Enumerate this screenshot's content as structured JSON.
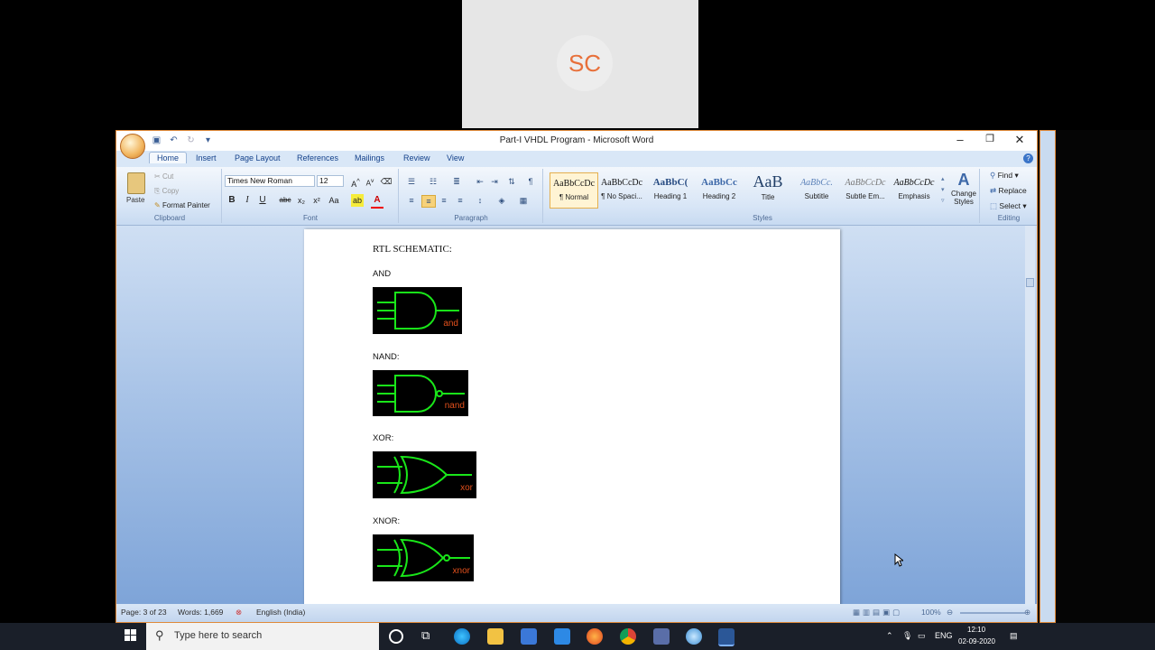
{
  "participant": {
    "initials": "SC"
  },
  "window": {
    "title": "Part-I VHDL Program - Microsoft Word",
    "tabs": [
      "Home",
      "Insert",
      "Page Layout",
      "References",
      "Mailings",
      "Review",
      "View"
    ],
    "active_tab": "Home"
  },
  "ribbon": {
    "clipboard": {
      "label": "Clipboard",
      "paste": "Paste",
      "cut": "Cut",
      "copy": "Copy",
      "format_painter": "Format Painter"
    },
    "font": {
      "label": "Font",
      "family": "Times New Roman",
      "size": "12"
    },
    "paragraph": {
      "label": "Paragraph"
    },
    "styles": {
      "label": "Styles",
      "items": [
        {
          "sample": "AaBbCcDc",
          "name": "¶ Normal"
        },
        {
          "sample": "AaBbCcDc",
          "name": "¶ No Spaci..."
        },
        {
          "sample": "AaBbC(",
          "name": "Heading 1"
        },
        {
          "sample": "AaBbCc",
          "name": "Heading 2"
        },
        {
          "sample": "AaB",
          "name": "Title"
        },
        {
          "sample": "AaBbCc.",
          "name": "Subtitle"
        },
        {
          "sample": "AaBbCcDc",
          "name": "Subtle Em..."
        },
        {
          "sample": "AaBbCcDc",
          "name": "Emphasis"
        }
      ],
      "change_styles": "Change Styles"
    },
    "editing": {
      "label": "Editing",
      "find": "Find",
      "replace": "Replace",
      "select": "Select"
    }
  },
  "document": {
    "heading": "RTL SCHEMATIC:",
    "sections": [
      {
        "label": "AND",
        "gate_label": "and"
      },
      {
        "label": "NAND:",
        "gate_label": "nand"
      },
      {
        "label": "XOR:",
        "gate_label": "xor"
      },
      {
        "label": "XNOR:",
        "gate_label": "xnor"
      }
    ]
  },
  "status_bar": {
    "page": "Page: 3 of 23",
    "words": "Words: 1,669",
    "language": "English (India)",
    "zoom": "100%"
  },
  "taskbar": {
    "search_placeholder": "Type here to search",
    "language": "ENG",
    "time": "12:10",
    "date": "02-09-2020"
  },
  "colors": {
    "gate_wire": "#19e619",
    "gate_label": "#e2501c",
    "window_border": "#e08a3a",
    "avatar_text": "#e8703a"
  }
}
